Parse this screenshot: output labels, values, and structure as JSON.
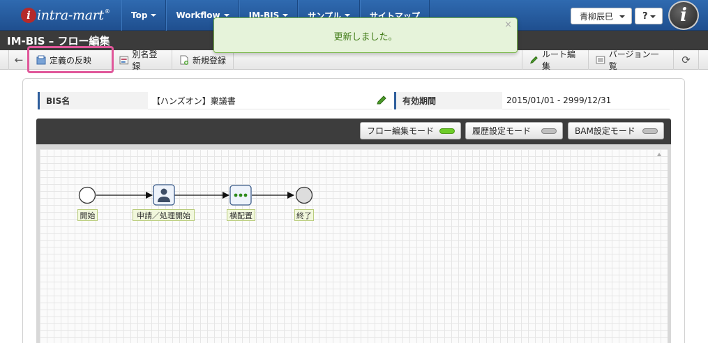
{
  "app": {
    "logo": "intra-mart",
    "logo_mark": "i",
    "logo_reg": "®"
  },
  "nav": {
    "items": [
      {
        "label": "Top"
      },
      {
        "label": "Workflow"
      },
      {
        "label": "IM-BIS"
      },
      {
        "label": "サンプル"
      },
      {
        "label": "サイトマップ"
      }
    ],
    "user": "青柳辰巳",
    "help": "?"
  },
  "page": {
    "title": "IM-BIS – フロー編集"
  },
  "toast": {
    "message": "更新しました。",
    "close": "×"
  },
  "toolbar": {
    "back": "←",
    "reflect": "定義の反映",
    "alias": "別名登録",
    "new": "新規登録",
    "route": "ルート編集",
    "versions": "バージョン一覧",
    "refresh": "⟳"
  },
  "info": {
    "bis_name_label": "BIS名",
    "bis_name_value": "【ハンズオン】稟議書",
    "period_label": "有効期間",
    "period_value": "2015/01/01 - 2999/12/31"
  },
  "modes": {
    "flow_edit": "フロー編集モード",
    "history": "履歴設定モード",
    "bam": "BAM設定モード"
  },
  "flow": {
    "nodes": [
      {
        "label": "開始",
        "type": "start"
      },
      {
        "label": "申請／処理開始",
        "type": "user-task"
      },
      {
        "label": "横配置",
        "type": "horizontal"
      },
      {
        "label": "終了",
        "type": "end"
      }
    ]
  },
  "colors": {
    "nav_bg": "#2a62a8",
    "title_bg": "#3b3b3b",
    "highlight": "#e0579a",
    "toast_bg": "#e6f3da",
    "toast_text": "#3e7a14",
    "led_on": "#6dcc28"
  }
}
